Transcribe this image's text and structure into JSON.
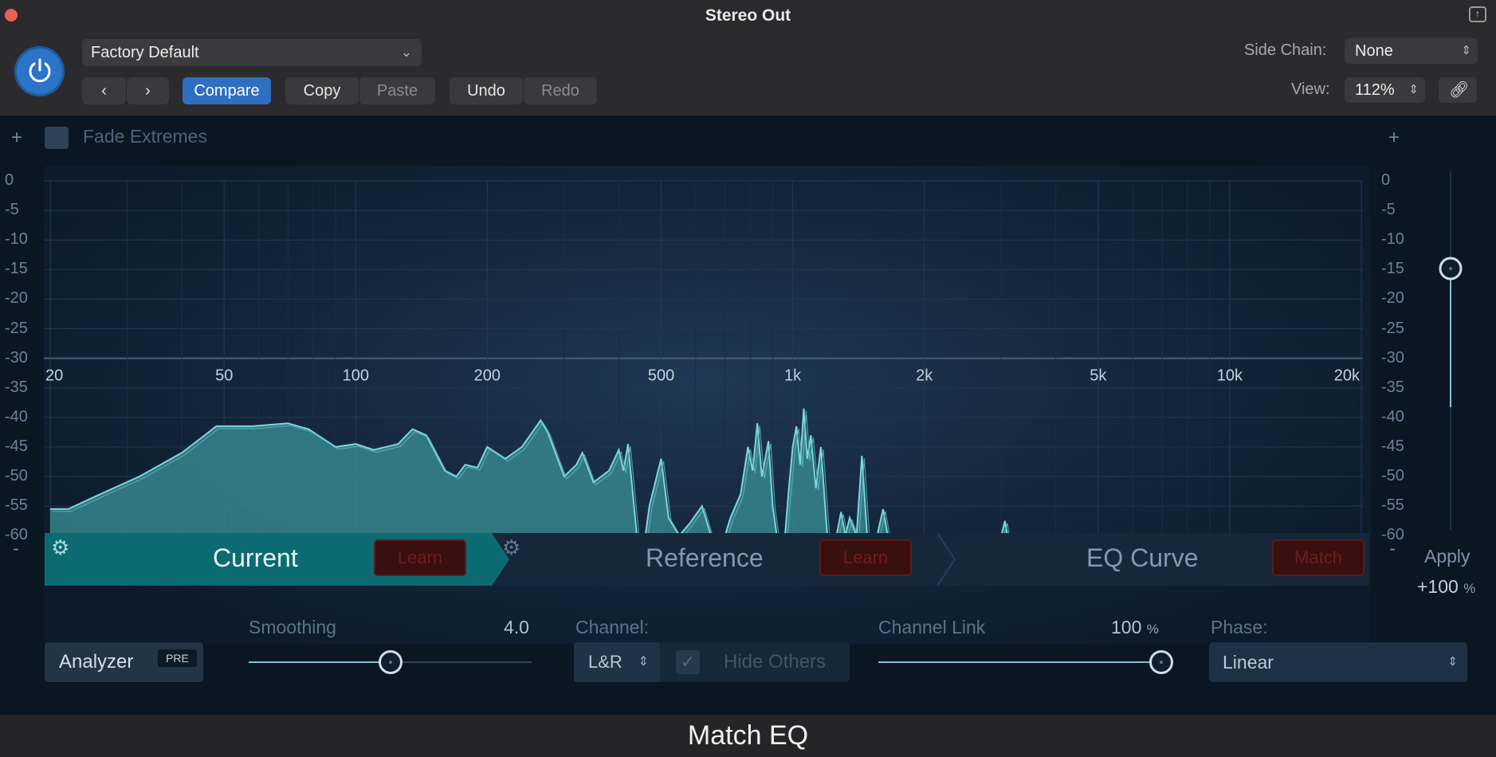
{
  "window": {
    "title": "Stereo Out",
    "footer_title": "Match EQ"
  },
  "header": {
    "preset": "Factory Default",
    "compare_label": "Compare",
    "copy_label": "Copy",
    "paste_label": "Paste",
    "undo_label": "Undo",
    "redo_label": "Redo",
    "side_chain_label": "Side Chain:",
    "side_chain_value": "None",
    "view_label": "View:",
    "view_value": "112%"
  },
  "graph": {
    "fade_extremes_label": "Fade Extremes",
    "fade_extremes_checked": false,
    "db_ticks": [
      "0",
      "-5",
      "-10",
      "-15",
      "-20",
      "-25",
      "-30",
      "-35",
      "-40",
      "-45",
      "-50",
      "-55",
      "-60"
    ],
    "freq_ticks": [
      "20",
      "50",
      "100",
      "200",
      "500",
      "1k",
      "2k",
      "5k",
      "10k",
      "20k"
    ],
    "accent_color": "#5fc6cc"
  },
  "tabs": {
    "current_label": "Current",
    "reference_label": "Reference",
    "eq_curve_label": "EQ Curve",
    "learn_label": "Learn",
    "match_label": "Match"
  },
  "apply": {
    "label": "Apply",
    "value": "+100",
    "unit": "%",
    "level_percent": 100
  },
  "controls": {
    "analyzer_label": "Analyzer",
    "analyzer_mode": "PRE",
    "smoothing_label": "Smoothing",
    "smoothing_value": "4.0",
    "smoothing_fraction": 0.5,
    "channel_label": "Channel:",
    "channel_value": "L&R",
    "hide_others_label": "Hide Others",
    "hide_others_checked": true,
    "channel_link_label": "Channel Link",
    "channel_link_value": "100",
    "channel_link_unit": "%",
    "channel_link_fraction": 1.0,
    "phase_label": "Phase:",
    "phase_value": "Linear"
  }
}
